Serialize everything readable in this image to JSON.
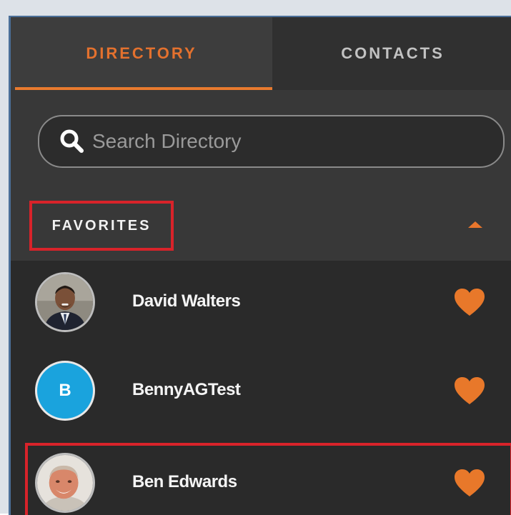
{
  "tabs": [
    {
      "label": "DIRECTORY",
      "active": true
    },
    {
      "label": "CONTACTS",
      "active": false
    }
  ],
  "search": {
    "placeholder": "Search Directory",
    "value": "",
    "icon": "search-icon"
  },
  "favorites": {
    "header": "FAVORITES",
    "collapse_icon": "caret-up-icon",
    "highlighted": true
  },
  "contacts": [
    {
      "name": "David Walters",
      "avatar": "photo",
      "favorite": true,
      "highlighted": false
    },
    {
      "name": "BennyAGTest",
      "avatar_initial": "B",
      "favorite": true,
      "highlighted": false
    },
    {
      "name": "Ben Edwards",
      "avatar": "photo",
      "favorite": true,
      "highlighted": true
    }
  ],
  "colors": {
    "accent": "#e87a2e",
    "highlight": "#d8232a",
    "avatar_blue": "#1aa3dd",
    "panel": "#383838"
  }
}
